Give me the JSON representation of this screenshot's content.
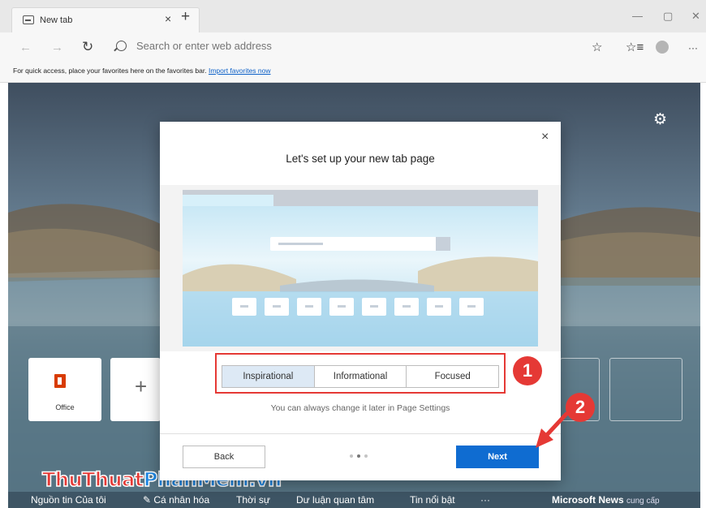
{
  "browser": {
    "tab_title": "New tab",
    "tab_close": "×",
    "new_tab": "+",
    "window_buttons": [
      "—",
      "▢",
      "✕"
    ],
    "address_placeholder": "Search or enter web address",
    "favorites_bar": {
      "message": "For quick access, place your favorites here on the favorites bar.",
      "link": "Import favorites now"
    },
    "toolbar_icons": [
      "star-icon",
      "favorites-icon",
      "profile-icon",
      "more-icon"
    ],
    "more_label": "···"
  },
  "newtab": {
    "quick_links": [
      {
        "label": "Office"
      },
      {
        "label": "+"
      }
    ],
    "bottom_nav": [
      "Nguồn tin Của tôi",
      "✎ Cá nhân hóa",
      "Thời sự",
      "Dư luận quan tâm",
      "Tin nổi bật",
      "···"
    ],
    "msn_label": "Microsoft News",
    "msn_provided": "cung cấp"
  },
  "dialog": {
    "title": "Let's set up your new tab page",
    "close": "×",
    "layout_options": [
      "Inspirational",
      "Informational",
      "Focused"
    ],
    "selected_layout": "Inspirational",
    "hint": "You can always change it later in Page Settings",
    "back_label": "Back",
    "next_label": "Next",
    "page_dots": 3,
    "active_dot": 2
  },
  "annotations": {
    "step1": "1",
    "step2": "2",
    "accent": "#e53935"
  },
  "watermark": {
    "part1": "ThuThuat",
    "part2": "PhanMem.vn"
  }
}
